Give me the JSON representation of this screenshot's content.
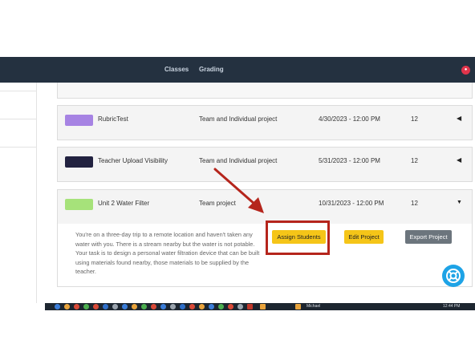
{
  "nav": {
    "items": [
      {
        "label": "Classes"
      },
      {
        "label": "Grading"
      }
    ]
  },
  "projects": [
    {
      "name": "RubricTest",
      "type": "Team and Individual project",
      "due": "4/30/2023 - 12:00 PM",
      "count": "12",
      "color": "#a683e3"
    },
    {
      "name": "Teacher Upload Visibility",
      "type": "Team and Individual project",
      "due": "5/31/2023 - 12:00 PM",
      "count": "12",
      "color": "#222240"
    },
    {
      "name": "Unit 2 Water Filter",
      "type": "Team project",
      "due": "10/31/2023 - 12:00 PM",
      "count": "12",
      "color": "#a6e27a"
    }
  ],
  "expanded": {
    "description": "You're on a three-day trip to a remote location and haven't taken any water with you. There is a stream nearby but the water is not potable. Your task is to design a personal water filtration device that can be built using materials found nearby, those materials to be supplied by the teacher.",
    "assign_label": "Assign Students",
    "edit_label": "Edit Project",
    "export_label": "Export Project"
  },
  "taskbar": {
    "window_label": "Michael",
    "time": "12:44 PM"
  },
  "colors": {
    "accent_yellow": "#f5c518",
    "annotation_red": "#b5251c",
    "nav_bg": "#243140",
    "help_blue": "#1ea3e6"
  }
}
